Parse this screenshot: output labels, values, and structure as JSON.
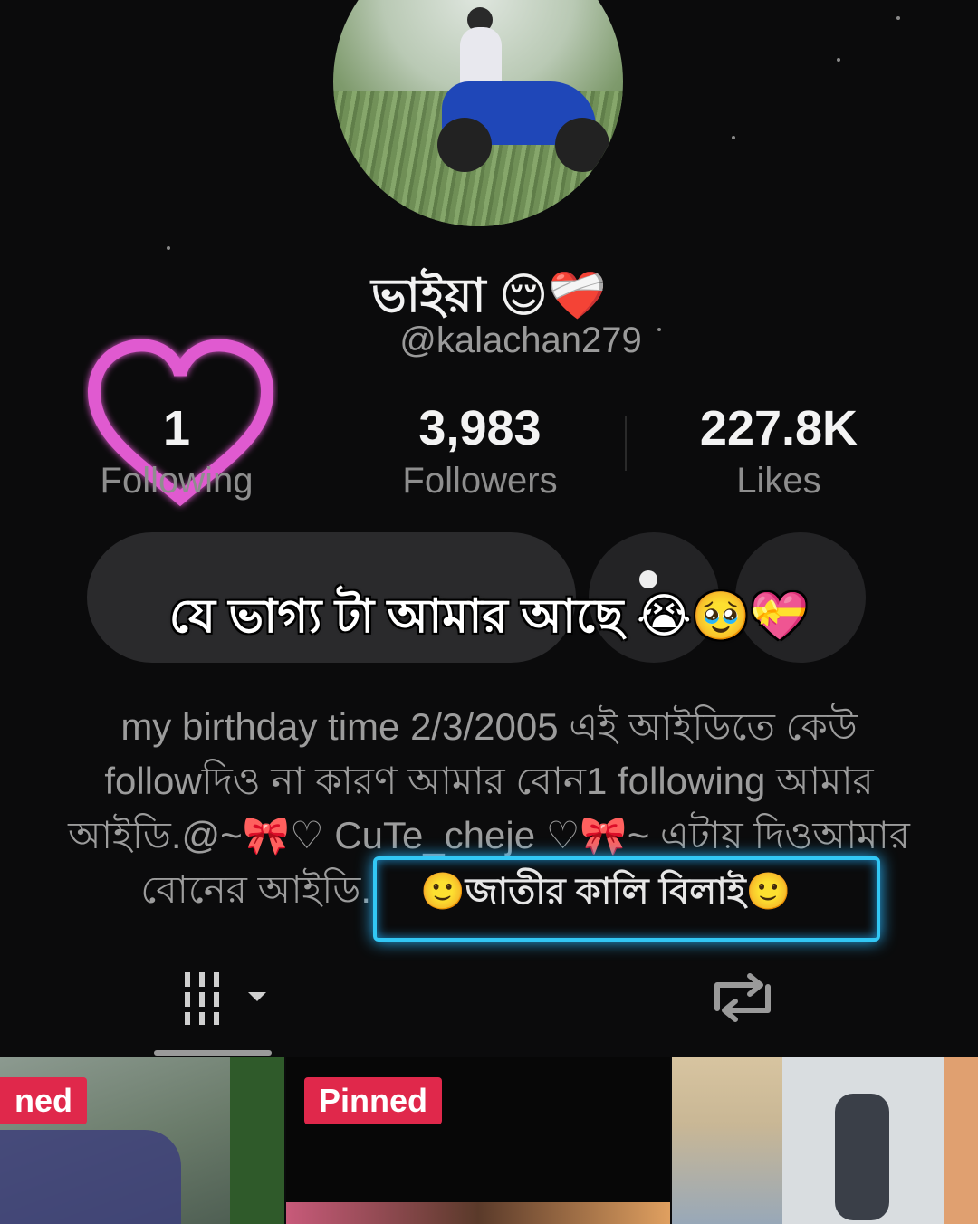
{
  "profile": {
    "display_name": "ভাইয়া 😌❤️‍🩹",
    "handle": "@kalachan279",
    "avatar_subject": "person sitting on blue motorcycle in grass field"
  },
  "stats": [
    {
      "value": "1",
      "label": "Following"
    },
    {
      "value": "3,983",
      "label": "Followers"
    },
    {
      "value": "227.8K",
      "label": "Likes"
    }
  ],
  "overlay_caption": "যে ভাগ্য টা আমার আছে 😭🥹💝",
  "bio": {
    "line1": "my birthday time 2/3/2005 এই আইডিতে কেউ",
    "line2": "followদিও না কারণ আমার বোন1 following আমার",
    "line3": "আইডি.@~🎀♡ CuTe_cheje ♡🎀~ এটায় দিওআমার",
    "line4": "বোনের আইডি.",
    "highlight": "🙂জাতীর কালি বিলাই🙂"
  },
  "tabs": {
    "videos_icon": "grid-icon",
    "repost_icon": "repost-icon"
  },
  "thumbnails": [
    {
      "badge": "ned"
    },
    {
      "badge": "Pinned"
    },
    {
      "badge": ""
    }
  ],
  "colors": {
    "background": "#0b0b0c",
    "pinned_badge": "#e0284b",
    "highlight_border": "#32c7f5",
    "heart": "#e05ad0"
  }
}
